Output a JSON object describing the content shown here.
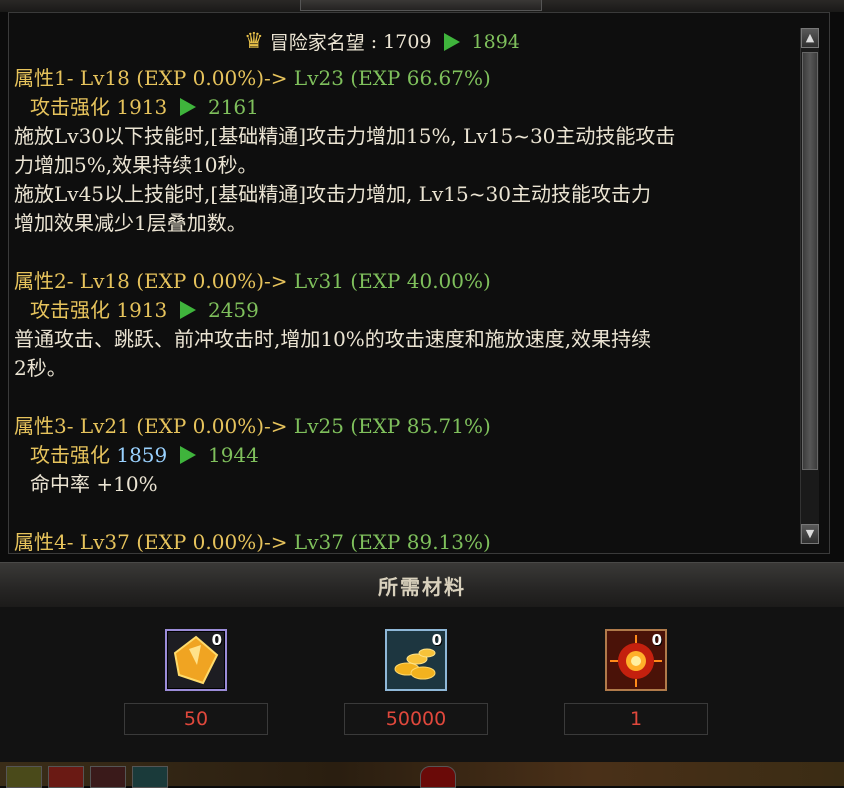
{
  "reputation": {
    "label": "冒险家名望",
    "separator": ":",
    "from": "1709",
    "to": "1894"
  },
  "attributes": [
    {
      "head": "属性1-",
      "from_lv": "Lv18 (EXP 0.00%)->",
      "to_lv": "Lv23 (EXP 66.67%)",
      "boost_label": "攻击强化",
      "boost_from": "1913",
      "boost_to": "2161",
      "desc": [
        "施放Lv30以下技能时,[基础精通]攻击力增加15%, Lv15~30主动技能攻击",
        "力增加5%,效果持续10秒。",
        "施放Lv45以上技能时,[基础精通]攻击力增加, Lv15~30主动技能攻击力",
        "增加效果减少1层叠加数。"
      ]
    },
    {
      "head": "属性2-",
      "from_lv": "Lv18 (EXP 0.00%)->",
      "to_lv": "Lv31 (EXP 40.00%)",
      "boost_label": "攻击强化",
      "boost_from": "1913",
      "boost_to": "2459",
      "desc": [
        "普通攻击、跳跃、前冲攻击时,增加10%的攻击速度和施放速度,效果持续",
        "2秒。"
      ]
    },
    {
      "head": "属性3-",
      "from_lv": "Lv21 (EXP 0.00%)->",
      "to_lv": "Lv25 (EXP 85.71%)",
      "boost_label": "攻击强化",
      "boost_from": "1859",
      "boost_to": "1944",
      "desc": [
        "命中率 +10%"
      ]
    },
    {
      "head": "属性4-",
      "from_lv": "Lv37 (EXP 0.00%)->",
      "to_lv": "Lv37 (EXP 89.13%)"
    }
  ],
  "materials": {
    "title": "所需材料",
    "items": [
      {
        "icon": "gold-crystal-icon",
        "count": "0",
        "qty": "50"
      },
      {
        "icon": "gold-coins-icon",
        "count": "0",
        "qty": "50000"
      },
      {
        "icon": "red-sun-orb-icon",
        "count": "0",
        "qty": "1"
      }
    ]
  },
  "colors": {
    "gold": "#e6c35c",
    "green": "#7fc05c",
    "blue": "#9ad2ff",
    "red_qty": "#e0483c"
  }
}
